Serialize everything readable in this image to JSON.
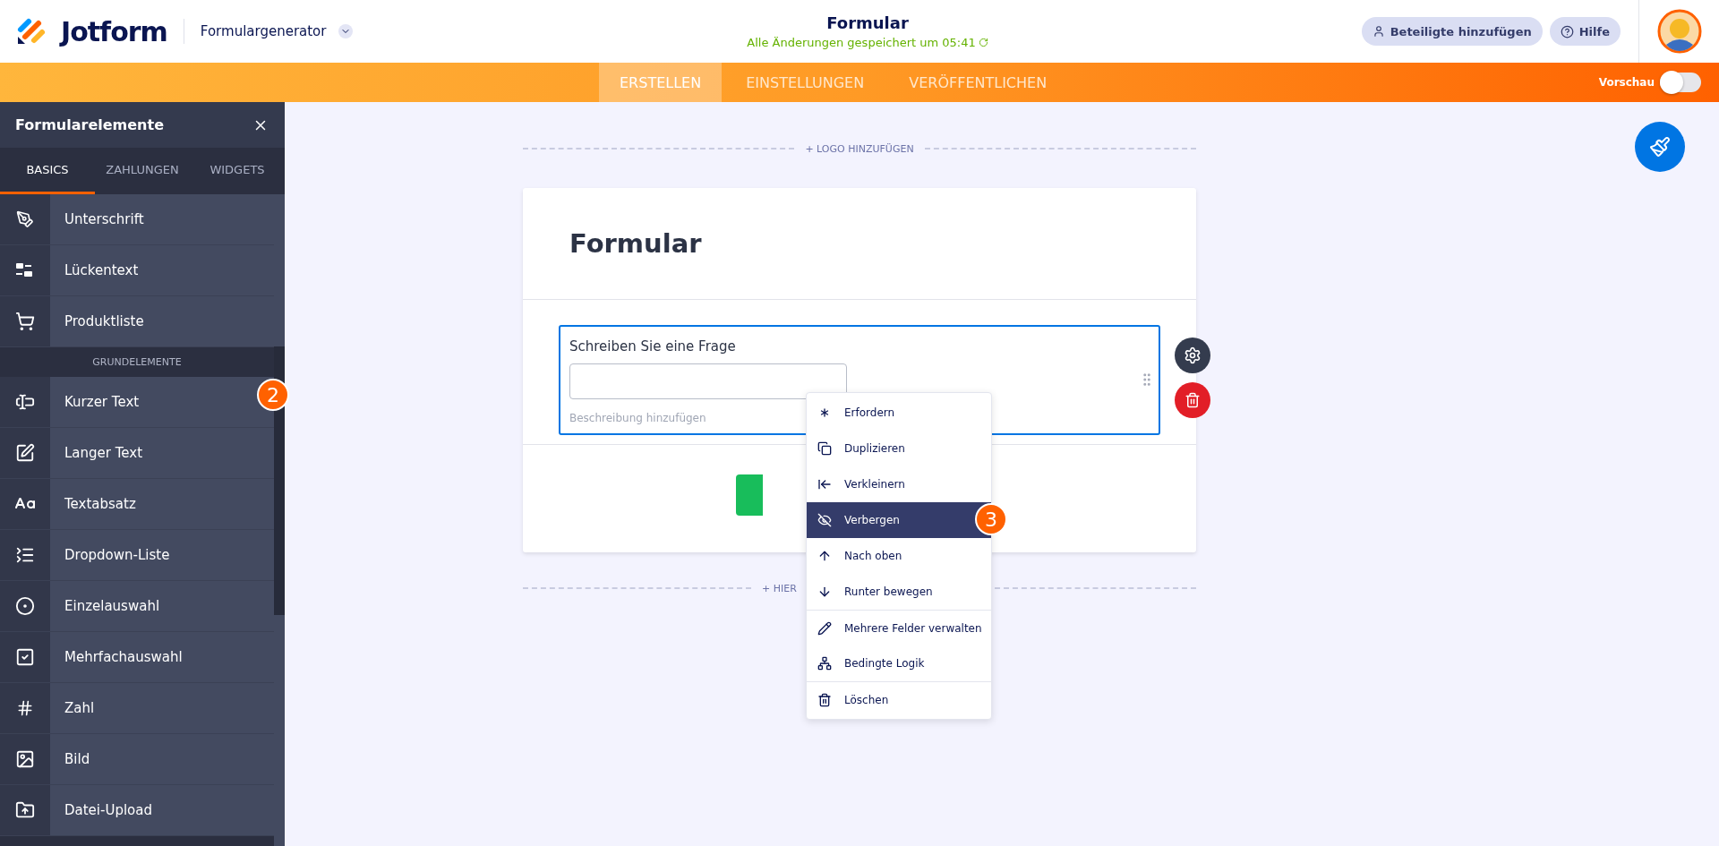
{
  "header": {
    "logo": "Jotform",
    "product": "Formulargenerator",
    "title": "Formular",
    "saved_status": "Alle Änderungen gespeichert um 05:41",
    "buttons": [
      "Beteiligte hinzufügen",
      "Hilfe"
    ]
  },
  "nav": {
    "tabs": [
      {
        "label": "ERSTELLEN",
        "selected": true
      },
      {
        "label": "EINSTELLUNGEN",
        "selected": false
      },
      {
        "label": "VERÖFFENTLICHEN",
        "selected": false
      }
    ],
    "preview": {
      "label": "Vorschau",
      "on": false
    }
  },
  "sidebar": {
    "title": "Formularelemente",
    "tabs": [
      {
        "label": "BASICS",
        "selected": true
      },
      {
        "label": "ZAHLUNGEN",
        "selected": false
      },
      {
        "label": "WIDGETS",
        "selected": false
      }
    ],
    "items": [
      {
        "kind": "item",
        "label": "Unterschrift"
      },
      {
        "kind": "item",
        "label": "Lückentext"
      },
      {
        "kind": "item",
        "label": "Produktliste"
      },
      {
        "kind": "section",
        "label": "GRUNDELEMENTE"
      },
      {
        "kind": "item",
        "label": "Kurzer Text",
        "badge": "2"
      },
      {
        "kind": "item",
        "label": "Langer Text"
      },
      {
        "kind": "item",
        "label": "Textabsatz"
      },
      {
        "kind": "item",
        "label": "Dropdown-Liste"
      },
      {
        "kind": "item",
        "label": "Einzelauswahl"
      },
      {
        "kind": "item",
        "label": "Mehrfachauswahl"
      },
      {
        "kind": "item",
        "label": "Zahl"
      },
      {
        "kind": "item",
        "label": "Bild"
      },
      {
        "kind": "item",
        "label": "Datei-Upload"
      }
    ]
  },
  "canvas": {
    "logo_link": "+ LOGO HINZUFÜGEN",
    "form_title": "Formular",
    "question": {
      "label": "Schreiben Sie eine Frage",
      "description": "Beschreibung hinzufügen"
    },
    "bottom_link": "+ HIER"
  },
  "context_menu": {
    "items": [
      {
        "label": "Erfordern",
        "selected": false,
        "separated": false
      },
      {
        "label": "Duplizieren",
        "selected": false,
        "separated": false
      },
      {
        "label": "Verkleinern",
        "selected": false,
        "separated": false
      },
      {
        "label": "Verbergen",
        "selected": true,
        "separated": false,
        "badge": "3"
      },
      {
        "label": "Nach oben",
        "selected": false,
        "separated": false
      },
      {
        "label": "Runter bewegen",
        "selected": false,
        "separated": false
      },
      {
        "label": "Mehrere Felder verwalten",
        "selected": false,
        "separated": true
      },
      {
        "label": "Bedingte Logik",
        "selected": false,
        "separated": false
      },
      {
        "label": "Löschen",
        "selected": false,
        "separated": true
      }
    ]
  }
}
